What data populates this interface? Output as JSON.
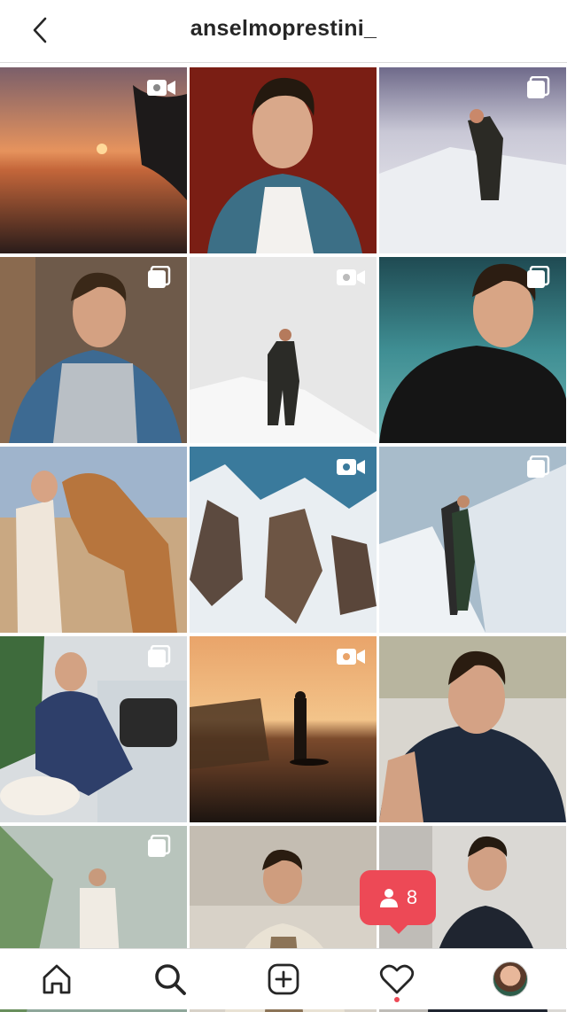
{
  "header": {
    "username": "anselmoprestini_"
  },
  "notification": {
    "follower_count": "8"
  },
  "colors": {
    "accent": "#ed4956",
    "text": "#262626",
    "divider": "#dbdbdb"
  },
  "grid": {
    "posts": [
      {
        "kind": "video"
      },
      {
        "kind": "photo"
      },
      {
        "kind": "carousel"
      },
      {
        "kind": "carousel"
      },
      {
        "kind": "video"
      },
      {
        "kind": "carousel"
      },
      {
        "kind": "photo"
      },
      {
        "kind": "video"
      },
      {
        "kind": "carousel"
      },
      {
        "kind": "carousel"
      },
      {
        "kind": "video"
      },
      {
        "kind": "photo"
      },
      {
        "kind": "carousel"
      },
      {
        "kind": "photo"
      },
      {
        "kind": "photo"
      }
    ]
  },
  "nav": {
    "items": [
      "home-icon",
      "search-icon",
      "add-post-icon",
      "activity-heart-icon",
      "profile-avatar"
    ]
  }
}
